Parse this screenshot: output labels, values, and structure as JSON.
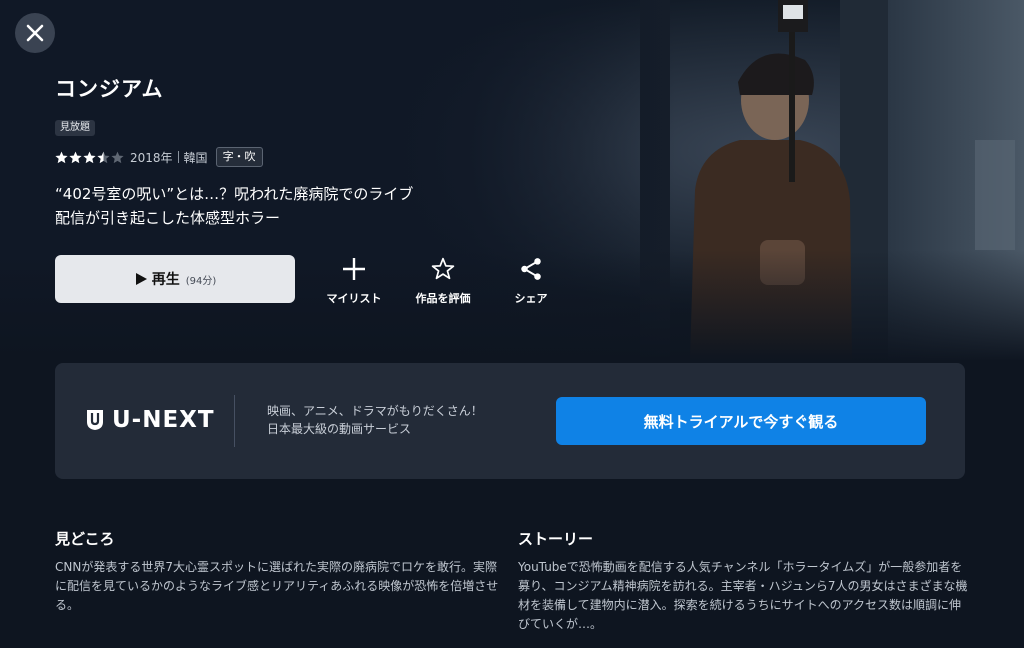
{
  "window": {
    "close_icon": "close-icon"
  },
  "title": "コンジアム",
  "badges": {
    "free": "見放題",
    "lang": "字・吹"
  },
  "meta": {
    "rating": 3.5,
    "year": "2018年",
    "country": "韓国"
  },
  "tagline": "“402号室の呪い”とは…？呪われた廃病院でのライブ配信が引き起こした体感型ホラー",
  "play": {
    "icon": "play-icon",
    "label": "再生",
    "duration": "(94分)"
  },
  "actions": [
    {
      "icon": "plus-icon",
      "label": "マイリスト"
    },
    {
      "icon": "star-outline-icon",
      "label": "作品を評価"
    },
    {
      "icon": "share-icon",
      "label": "シェア"
    }
  ],
  "promo": {
    "logo_text": "U-NEXT",
    "line1": "映画、アニメ、ドラマがもりだくさん！",
    "line2": "日本最大級の動画サービス",
    "cta": "無料トライアルで今すぐ観る"
  },
  "highlights": {
    "title": "見どころ",
    "body": "CNNが発表する世界7大心霊スポットに選ばれた実際の廃病院でロケを敢行。実際に配信を見ているかのようなライブ感とリアリティあふれる映像が恐怖を倍増させる。"
  },
  "story": {
    "title": "ストーリー",
    "body": "YouTubeで恐怖動画を配信する人気チャンネル「ホラータイムズ」が一般参加者を募り、コンジアム精神病院を訪れる。主宰者・ハジュンら7人の男女はさまざまな機材を装備して建物内に潜入。探索を続けるうちにサイトへのアクセス数は順調に伸びていくが…。"
  },
  "colors": {
    "background": "#0e1520",
    "promo_bg": "#232b38",
    "cta": "#0f82e6",
    "star": "#ffffff"
  }
}
